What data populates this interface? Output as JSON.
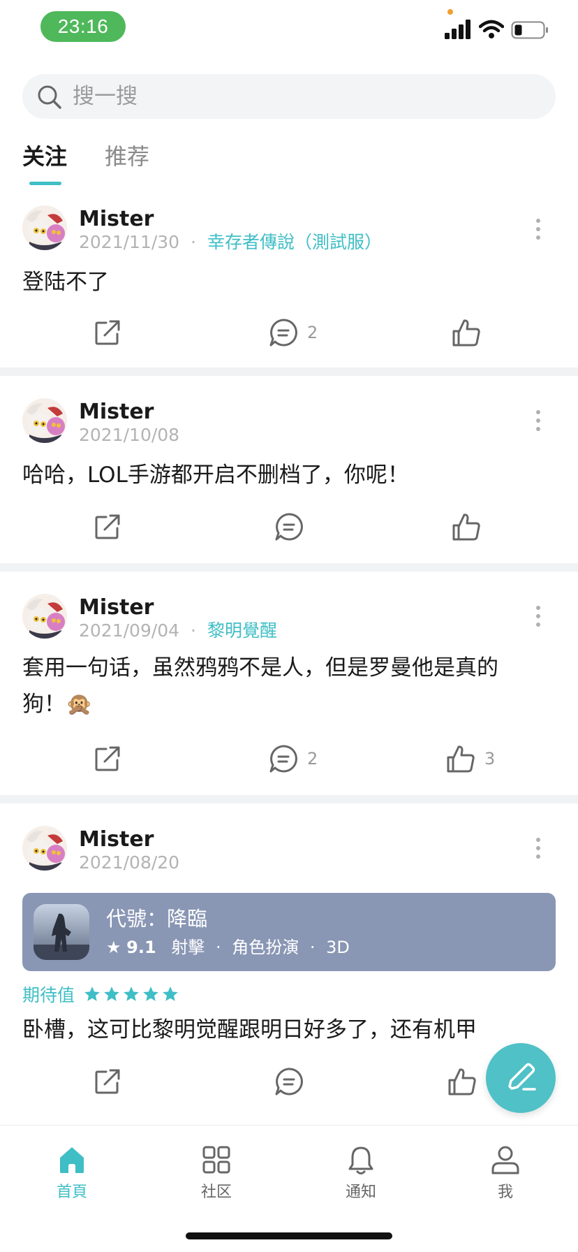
{
  "status_bar": {
    "time": "23:16"
  },
  "search": {
    "placeholder": "搜一搜"
  },
  "tabs": [
    {
      "label": "关注",
      "active": true
    },
    {
      "label": "推荐",
      "active": false
    }
  ],
  "posts": [
    {
      "author": "Mister",
      "date": "2021/11/30",
      "separator": "·",
      "game": "幸存者傳說（測試服）",
      "body": "登陆不了",
      "comments": "2",
      "likes": ""
    },
    {
      "author": "Mister",
      "date": "2021/10/08",
      "body": "哈哈，LOL手游都开启不删档了，你呢！",
      "comments": "",
      "likes": ""
    },
    {
      "author": "Mister",
      "date": "2021/09/04",
      "separator": "·",
      "game": "黎明覺醒",
      "body_line1": "套用一句话，虽然鸦鸦不是人，但是罗曼他是真的",
      "body_line2": "狗！🙊",
      "comments": "2",
      "likes": "3"
    },
    {
      "author": "Mister",
      "date": "2021/08/20",
      "game_card": {
        "title": "代號：降臨",
        "score": "9.1",
        "tags": [
          "射擊",
          "角色扮演",
          "3D"
        ],
        "separator": "·"
      },
      "expect_label": "期待值",
      "stars": 5,
      "body": "卧槽，这可比黎明觉醒跟明日好多了，还有机甲",
      "comments": "",
      "likes": ""
    }
  ],
  "bottom_nav": [
    {
      "label": "首頁",
      "active": true
    },
    {
      "label": "社区",
      "active": false
    },
    {
      "label": "通知",
      "active": false
    },
    {
      "label": "我",
      "active": false
    }
  ],
  "colors": {
    "accent": "#3fbec6",
    "status_time_bg": "#4fb85a",
    "game_card_bg": "#8996b4",
    "fab_bg": "#4fc1c7"
  }
}
